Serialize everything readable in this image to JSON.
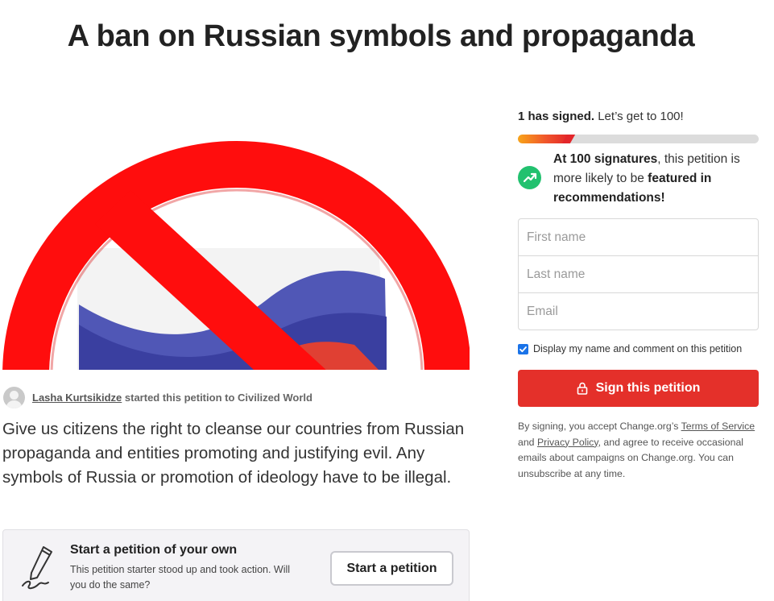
{
  "petition": {
    "title": "A ban on Russian symbols and propaganda",
    "starter": {
      "name": "Lasha Kurtsikidze",
      "action_text": "started this petition to Civilized World"
    },
    "description": "Give us citizens the right to cleanse our countries from Russian propaganda and entities promoting and justifying evil. Any symbols of Russia or promotion of ideology have to be illegal."
  },
  "start_petition": {
    "title": "Start a petition of your own",
    "text": "This petition starter stood up and took action. Will you do the same?",
    "button_label": "Start a petition"
  },
  "signatures": {
    "signed_count_text": "1 has signed.",
    "goal_text": "Let’s get to 100!",
    "progress_fraction": 0.21,
    "milestone_prefix_bold": "At 100 signatures",
    "milestone_middle": ", this petition is more likely to be ",
    "milestone_suffix_bold": "featured in recommendations!"
  },
  "form": {
    "first_name_placeholder": "First name",
    "last_name_placeholder": "Last name",
    "email_placeholder": "Email",
    "display_checkbox_label": "Display my name and comment on this petition",
    "display_checked": true,
    "sign_button_label": "Sign this petition"
  },
  "legal": {
    "prefix": "By signing, you accept Change.org’s ",
    "terms_link": "Terms of Service",
    "and": " and ",
    "privacy_link": "Privacy Policy",
    "suffix": ", and agree to receive occasional emails about campaigns on Change.org. You can unsubscribe at any time."
  },
  "icons": {
    "avatar": "user-avatar-icon",
    "pen": "pen-signature-icon",
    "trend": "trending-up-icon",
    "lock": "lock-icon",
    "check": "check-icon"
  },
  "colors": {
    "sign_button": "#e4302a",
    "trend_circle": "#22c16f",
    "checkbox": "#1a73e8"
  }
}
